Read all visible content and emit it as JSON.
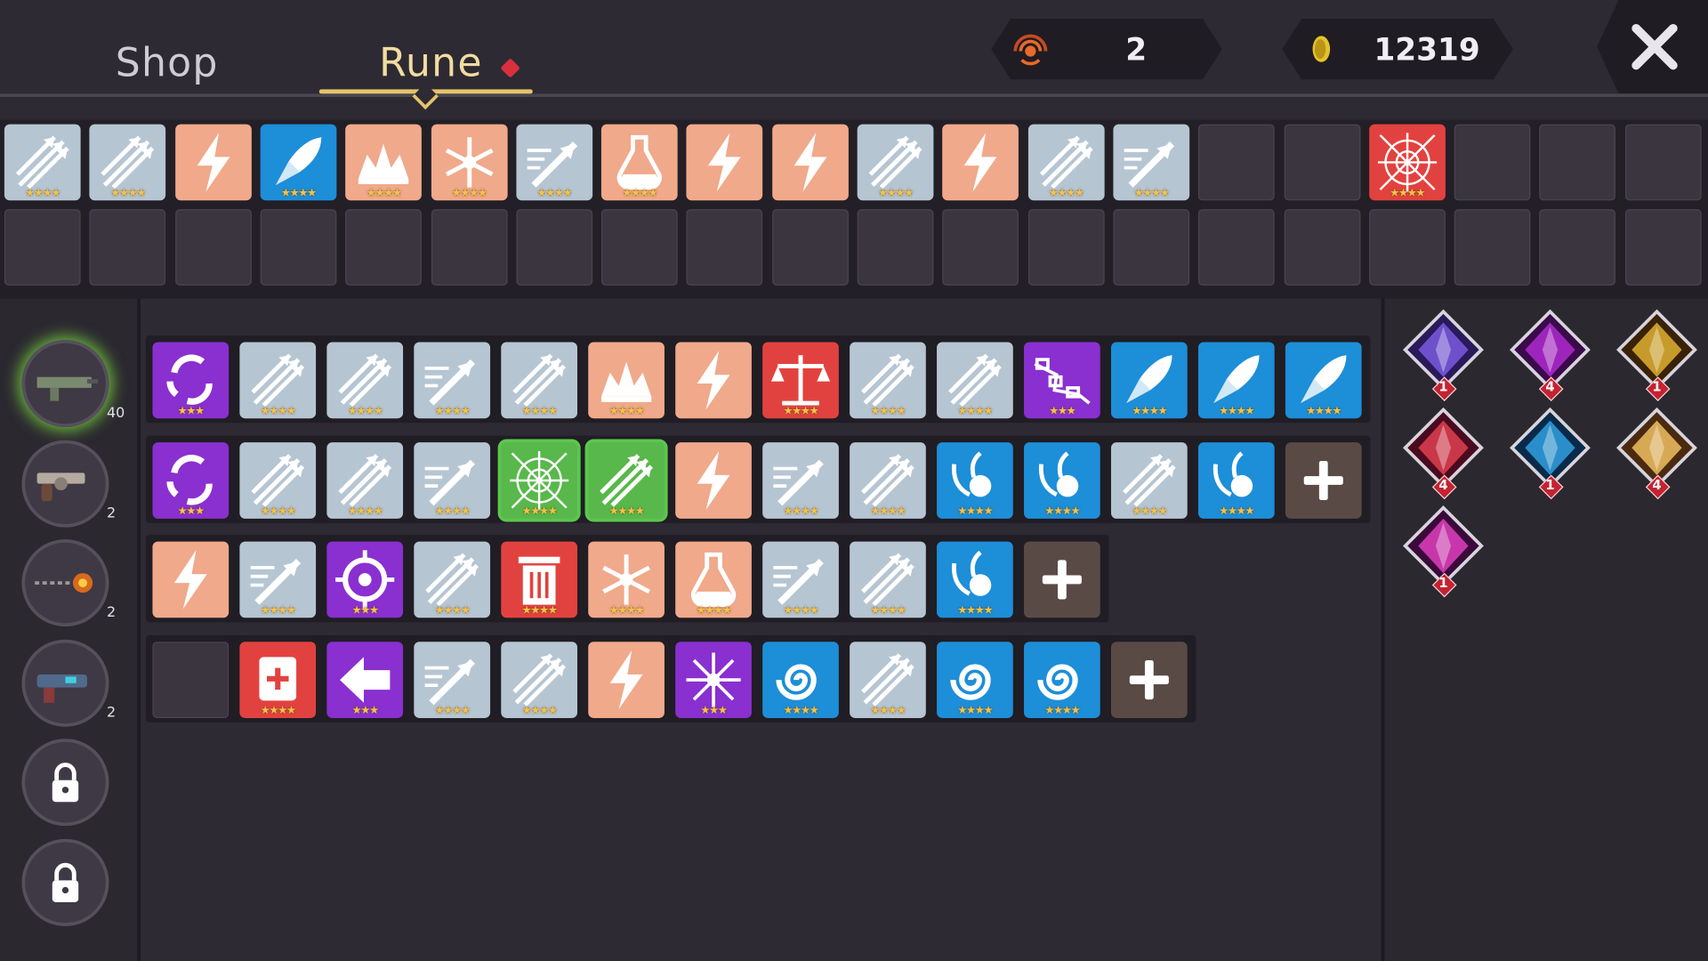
{
  "tabs": {
    "shop": "Shop",
    "rune": "Rune",
    "active": "Rune"
  },
  "resources": {
    "energy": {
      "icon": "signal-energy-icon",
      "value": "2"
    },
    "gold": {
      "icon": "gold-coin-icon",
      "value": "12319"
    }
  },
  "inventory": {
    "row1": [
      "multishot",
      "multishot",
      "lightning",
      "rocket",
      "burst",
      "frost",
      "pierce",
      "potion",
      "lightning",
      "lightning",
      "multishot",
      "lightning",
      "multishot",
      "pierce",
      "empty",
      "empty",
      "web",
      "empty",
      "empty",
      "empty"
    ],
    "row2": [
      "empty",
      "empty",
      "empty",
      "empty",
      "empty",
      "empty",
      "empty",
      "empty",
      "empty",
      "empty",
      "empty",
      "empty",
      "empty",
      "empty",
      "empty",
      "empty",
      "empty",
      "empty",
      "empty",
      "empty"
    ]
  },
  "weapons": [
    {
      "name": "assault-rifle",
      "count": "40"
    },
    {
      "name": "revolver",
      "count": "2"
    },
    {
      "name": "flail",
      "count": "2"
    },
    {
      "name": "blaster",
      "count": "2"
    },
    {
      "name": "locked",
      "count": ""
    },
    {
      "name": "locked",
      "count": ""
    }
  ],
  "loadout": [
    [
      "cycle",
      "multishot",
      "multishot",
      "pierce",
      "multishot",
      "burst",
      "lightning",
      "balance",
      "multishot",
      "multishot",
      "chain",
      "rocket",
      "rocket",
      "rocket"
    ],
    [
      "cycle",
      "multishot",
      "multishot",
      "pierce",
      "web",
      "multishot",
      "lightning",
      "pierce",
      "multishot",
      "comet",
      "comet",
      "multishot",
      "comet",
      "plus"
    ],
    [
      "lightning",
      "pierce",
      "target",
      "multishot",
      "trash",
      "frost",
      "potion",
      "pierce",
      "multishot",
      "comet",
      "plus"
    ],
    [
      "empty",
      "heal",
      "arrow-left",
      "pierce",
      "multishot",
      "lightning",
      "scatter",
      "swirl",
      "multishot",
      "swirl",
      "swirl",
      "plus"
    ]
  ],
  "gems": [
    {
      "name": "violet-shard",
      "level": "1"
    },
    {
      "name": "void-vortex",
      "level": "4"
    },
    {
      "name": "golden-flare",
      "level": "1"
    },
    {
      "name": "crimson-flame",
      "level": "4"
    },
    {
      "name": "blue-vortex",
      "level": "1"
    },
    {
      "name": "golden-rays",
      "level": "4"
    },
    {
      "name": "magenta-crystal",
      "level": "1"
    }
  ],
  "rune_styles": {
    "multishot": {
      "color": "#b6c5d2",
      "stars": 4
    },
    "pierce": {
      "color": "#b6c5d2",
      "stars": 4
    },
    "lightning": {
      "color": "#f0a98a",
      "stars": 0
    },
    "burst": {
      "color": "#f0a98a",
      "stars": 4
    },
    "frost": {
      "color": "#f0a98a",
      "stars": 4
    },
    "potion": {
      "color": "#f0a98a",
      "stars": 4
    },
    "rocket": {
      "color": "#1d8ed8",
      "stars": 4
    },
    "comet": {
      "color": "#1d8ed8",
      "stars": 4
    },
    "swirl": {
      "color": "#1d8ed8",
      "stars": 4
    },
    "web": {
      "color": "#e2423f",
      "stars": 4
    },
    "balance": {
      "color": "#e2423f",
      "stars": 4
    },
    "trash": {
      "color": "#e2423f",
      "stars": 4
    },
    "heal": {
      "color": "#e2423f",
      "stars": 4
    },
    "cycle": {
      "color": "#8a2fd0",
      "stars": 3
    },
    "chain": {
      "color": "#8a2fd0",
      "stars": 3
    },
    "target": {
      "color": "#8a2fd0",
      "stars": 3
    },
    "arrow-left": {
      "color": "#8a2fd0",
      "stars": 3
    },
    "scatter": {
      "color": "#8a2fd0",
      "stars": 3
    }
  },
  "selected_cells": [
    [
      1,
      4
    ],
    [
      1,
      5
    ]
  ]
}
